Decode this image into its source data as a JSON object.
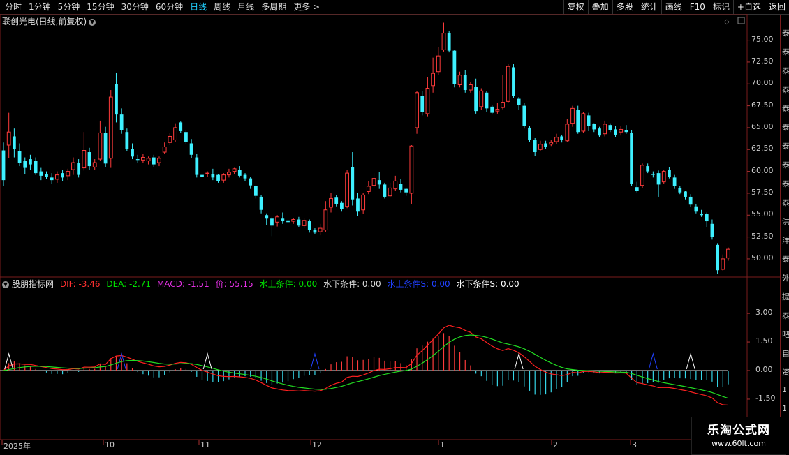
{
  "toolbar": {
    "periods": [
      "分时",
      "1分钟",
      "5分钟",
      "15分钟",
      "30分钟",
      "60分钟",
      "日线",
      "周线",
      "月线",
      "多周期",
      "更多 >"
    ],
    "active_period": "日线",
    "buttons": [
      "复权",
      "叠加",
      "多股",
      "统计",
      "画线",
      "F10",
      "标记",
      "+自选",
      "返回"
    ]
  },
  "main_panel": {
    "title": "联创光电(日线,前复权)",
    "price_ticks": [
      "75.00",
      "72.50",
      "70.00",
      "67.50",
      "65.00",
      "62.50",
      "60.00",
      "57.50",
      "55.00",
      "52.50",
      "50.00"
    ]
  },
  "indicator_panel": {
    "name": "股朋指标网",
    "dif_label": "DIF: -3.46",
    "dea_label": "DEA: -2.71",
    "macd_label": "MACD: -1.51",
    "price_label": "价: 55.15",
    "cond1_label": "水上条件: 0.00",
    "cond2_label": "水下条件: 0.00",
    "cond3_label": "水上条件S: 0.00",
    "cond4_label": "水下条件S: 0.00",
    "value_ticks": [
      "3.00",
      "1.50",
      "0.00",
      "-1.50"
    ],
    "colors": {
      "dif": "#ff3030",
      "dea": "#00e000",
      "macd": "#e030e0",
      "price": "#e030e0",
      "cond1": "#00e000",
      "cond2": "#dddddd",
      "cond3": "#2040ff",
      "cond4": "#ffffff"
    }
  },
  "x_axis": {
    "labels": [
      "2025年",
      "10",
      "11",
      "12",
      "1",
      "2",
      "3"
    ]
  },
  "right_strip": {
    "chars": [
      "泰",
      "泰",
      "泰",
      "泰",
      "泰",
      "泰",
      "泰",
      "泰",
      "泰",
      "泰",
      "洪",
      "洋",
      "泰",
      "外",
      "提",
      "泰",
      "吧",
      "自",
      "资",
      "1",
      "1",
      "1",
      "1"
    ]
  },
  "watermark": {
    "title": "乐淘公式网",
    "url": "www.60lt.com"
  },
  "chart_data": {
    "type": "candlestick",
    "title": "联创光电(日线,前复权)",
    "ylim": [
      48,
      78
    ],
    "candles": [
      [
        60.5,
        62.4,
        59.0,
        58.3,
        63.3
      ],
      [
        62.4,
        63.0,
        64.5,
        61.5,
        66.7
      ],
      [
        64.5,
        64.0,
        62.6,
        61.6,
        64.9
      ],
      [
        62.6,
        62.3,
        61.0,
        60.6,
        63.2
      ],
      [
        61.0,
        61.2,
        60.4,
        59.7,
        61.6
      ],
      [
        60.4,
        61.4,
        60.8,
        60.2,
        61.9
      ],
      [
        60.8,
        61.2,
        59.8,
        59.6,
        61.6
      ],
      [
        59.8,
        60.0,
        59.5,
        59.0,
        60.4
      ],
      [
        59.5,
        59.7,
        59.4,
        59.1,
        60.0
      ],
      [
        59.4,
        59.3,
        59.0,
        58.6,
        59.8
      ],
      [
        59.0,
        59.1,
        59.6,
        58.7,
        60.0
      ],
      [
        59.6,
        59.8,
        59.3,
        58.9,
        60.2
      ],
      [
        59.3,
        59.5,
        60.0,
        59.0,
        60.3
      ],
      [
        60.0,
        60.2,
        61.0,
        59.6,
        61.6
      ],
      [
        61.0,
        61.0,
        59.6,
        59.3,
        61.4
      ],
      [
        59.6,
        60.4,
        62.4,
        60.1,
        64.5
      ],
      [
        62.4,
        62.2,
        60.6,
        60.2,
        62.7
      ],
      [
        60.6,
        60.5,
        61.0,
        60.2,
        61.4
      ],
      [
        61.0,
        61.4,
        64.4,
        61.2,
        65.8
      ],
      [
        64.4,
        64.4,
        60.9,
        60.5,
        65.1
      ],
      [
        60.9,
        61.5,
        68.5,
        60.4,
        69.3
      ],
      [
        68.5,
        70.0,
        66.5,
        65.6,
        71.3
      ],
      [
        66.5,
        66.5,
        64.7,
        64.3,
        67.2
      ],
      [
        64.7,
        64.5,
        62.6,
        62.3,
        64.9
      ],
      [
        62.6,
        62.6,
        61.7,
        61.4,
        63.2
      ],
      [
        61.7,
        61.4,
        61.3,
        61.0,
        61.9
      ],
      [
        61.3,
        61.3,
        61.6,
        61.0,
        62.0
      ],
      [
        61.6,
        61.2,
        61.5,
        60.8,
        61.7
      ],
      [
        61.5,
        61.6,
        60.8,
        60.5,
        61.9
      ],
      [
        60.8,
        61.0,
        61.5,
        60.6,
        61.7
      ],
      [
        61.5,
        62.2,
        62.8,
        62.0,
        63.3
      ],
      [
        62.8,
        63.3,
        64.0,
        63.0,
        64.4
      ],
      [
        64.0,
        63.6,
        65.0,
        63.4,
        65.5
      ],
      [
        65.0,
        65.6,
        64.6,
        64.4,
        65.7
      ],
      [
        64.6,
        64.5,
        63.4,
        63.1,
        64.7
      ],
      [
        63.4,
        63.2,
        61.9,
        61.5,
        63.7
      ],
      [
        61.9,
        61.6,
        59.6,
        59.3,
        62.0
      ],
      [
        59.6,
        59.6,
        59.4,
        59.0,
        59.8
      ],
      [
        59.4,
        59.8,
        59.8,
        59.4,
        60.0
      ],
      [
        59.8,
        59.7,
        59.3,
        59.0,
        60.3
      ],
      [
        59.3,
        59.6,
        58.9,
        58.7,
        59.7
      ],
      [
        58.9,
        59.0,
        59.6,
        58.7,
        59.8
      ],
      [
        59.6,
        59.6,
        59.9,
        59.3,
        60.3
      ],
      [
        59.9,
        60.0,
        60.3,
        59.7,
        60.4
      ],
      [
        60.3,
        60.2,
        59.5,
        59.3,
        60.6
      ],
      [
        59.5,
        59.6,
        59.2,
        58.9,
        59.8
      ],
      [
        59.2,
        59.2,
        58.4,
        58.0,
        59.4
      ],
      [
        58.4,
        58.3,
        57.2,
        56.9,
        58.4
      ],
      [
        57.2,
        57.1,
        55.6,
        55.2,
        57.3
      ],
      [
        55.6,
        55.0,
        54.6,
        53.9,
        55.2
      ],
      [
        54.6,
        54.6,
        53.8,
        52.6,
        54.8
      ],
      [
        53.8,
        54.2,
        54.8,
        53.7,
        55.0
      ],
      [
        54.8,
        54.6,
        54.3,
        54.0,
        55.3
      ],
      [
        54.3,
        54.4,
        54.2,
        53.8,
        54.6
      ],
      [
        54.2,
        54.3,
        54.5,
        54.0,
        54.7
      ],
      [
        54.5,
        54.5,
        53.8,
        53.6,
        54.8
      ],
      [
        53.8,
        53.8,
        54.4,
        53.5,
        54.6
      ],
      [
        54.4,
        54.3,
        53.3,
        53.0,
        54.5
      ],
      [
        53.3,
        53.3,
        53.0,
        52.8,
        53.5
      ],
      [
        53.0,
        53.1,
        53.5,
        52.7,
        54.0
      ],
      [
        53.5,
        53.3,
        55.6,
        53.1,
        56.6
      ],
      [
        55.6,
        55.9,
        56.9,
        55.3,
        57.5
      ],
      [
        56.9,
        57.0,
        56.3,
        56.0,
        57.3
      ],
      [
        56.3,
        56.4,
        55.7,
        55.4,
        56.6
      ],
      [
        55.7,
        56.0,
        59.8,
        55.8,
        60.2
      ],
      [
        59.8,
        60.5,
        56.8,
        56.1,
        62.2
      ],
      [
        56.8,
        56.9,
        55.4,
        54.9,
        57.5
      ],
      [
        55.4,
        55.6,
        57.3,
        55.1,
        57.5
      ],
      [
        57.3,
        57.7,
        58.3,
        57.4,
        58.9
      ],
      [
        58.3,
        58.4,
        59.2,
        58.1,
        59.8
      ],
      [
        59.2,
        59.0,
        58.5,
        58.0,
        59.9
      ],
      [
        58.5,
        58.5,
        57.1,
        56.9,
        58.7
      ],
      [
        57.1,
        57.2,
        58.1,
        57.0,
        58.7
      ],
      [
        58.1,
        58.0,
        58.9,
        57.8,
        59.5
      ],
      [
        58.9,
        58.6,
        57.9,
        57.6,
        59.1
      ],
      [
        57.9,
        58.0,
        57.6,
        57.2,
        58.1
      ],
      [
        57.6,
        57.5,
        62.9,
        56.3,
        63.0
      ],
      [
        62.9,
        65.0,
        69.0,
        64.3,
        69.2
      ],
      [
        69.0,
        68.6,
        66.8,
        66.4,
        69.2
      ],
      [
        66.8,
        66.6,
        69.5,
        66.3,
        70.8
      ],
      [
        69.5,
        69.8,
        71.2,
        69.0,
        73.0
      ],
      [
        71.2,
        71.4,
        73.2,
        71.0,
        74.2
      ],
      [
        73.2,
        73.9,
        75.8,
        73.7,
        77.0
      ],
      [
        75.8,
        75.8,
        73.8,
        73.6,
        76.0
      ],
      [
        73.8,
        73.8,
        70.0,
        69.6,
        73.9
      ],
      [
        70.0,
        69.9,
        71.0,
        69.6,
        71.4
      ],
      [
        71.0,
        71.0,
        69.3,
        69.0,
        71.6
      ],
      [
        69.3,
        69.3,
        69.9,
        69.0,
        70.2
      ],
      [
        69.9,
        69.7,
        66.9,
        66.6,
        70.6
      ],
      [
        66.9,
        67.4,
        69.2,
        67.0,
        69.5
      ],
      [
        69.2,
        69.0,
        67.2,
        66.8,
        69.2
      ],
      [
        67.2,
        67.4,
        66.7,
        66.5,
        67.6
      ],
      [
        66.7,
        66.9,
        67.1,
        66.6,
        67.8
      ],
      [
        67.1,
        67.3,
        67.9,
        67.1,
        71.0
      ],
      [
        67.9,
        68.0,
        72.0,
        67.8,
        72.3
      ],
      [
        72.0,
        71.9,
        68.6,
        68.4,
        72.3
      ],
      [
        68.6,
        68.3,
        67.6,
        67.0,
        68.5
      ],
      [
        67.6,
        67.5,
        65.2,
        64.9,
        67.8
      ],
      [
        65.2,
        65.0,
        63.6,
        63.4,
        65.2
      ],
      [
        63.6,
        63.6,
        62.2,
        61.8,
        63.8
      ],
      [
        62.2,
        62.5,
        63.1,
        62.3,
        63.5
      ],
      [
        63.1,
        63.2,
        62.8,
        62.6,
        63.5
      ],
      [
        62.8,
        63.1,
        63.3,
        62.9,
        63.6
      ],
      [
        63.3,
        63.4,
        63.9,
        63.1,
        64.3
      ],
      [
        63.9,
        64.0,
        63.6,
        63.3,
        64.2
      ],
      [
        63.6,
        63.5,
        65.4,
        63.4,
        66.0
      ],
      [
        65.4,
        65.5,
        67.2,
        65.1,
        67.5
      ],
      [
        67.2,
        67.0,
        64.5,
        64.3,
        67.5
      ],
      [
        64.5,
        64.6,
        66.6,
        64.4,
        66.8
      ],
      [
        66.6,
        66.4,
        65.2,
        64.6,
        66.7
      ],
      [
        65.2,
        65.4,
        64.8,
        64.5,
        65.5
      ],
      [
        64.8,
        64.9,
        64.1,
        63.9,
        65.1
      ],
      [
        64.1,
        64.3,
        65.4,
        64.0,
        65.8
      ],
      [
        65.4,
        65.3,
        64.7,
        64.5,
        65.5
      ],
      [
        64.7,
        64.8,
        64.2,
        63.9,
        65.2
      ],
      [
        64.2,
        64.5,
        64.8,
        64.1,
        65.2
      ],
      [
        64.8,
        64.7,
        64.5,
        64.3,
        65.3
      ],
      [
        64.5,
        64.4,
        58.6,
        58.3,
        64.7
      ],
      [
        58.6,
        58.2,
        57.8,
        57.6,
        58.8
      ],
      [
        57.8,
        58.4,
        60.7,
        58.1,
        60.9
      ],
      [
        60.7,
        60.6,
        60.0,
        59.8,
        60.9
      ],
      [
        60.0,
        59.7,
        59.6,
        59.3,
        60.0
      ],
      [
        59.6,
        59.8,
        58.5,
        57.1,
        60.1
      ],
      [
        58.5,
        58.8,
        60.0,
        58.6,
        60.2
      ],
      [
        60.0,
        60.2,
        59.4,
        59.2,
        60.5
      ],
      [
        59.4,
        59.3,
        58.3,
        58.0,
        59.6
      ],
      [
        58.3,
        58.1,
        57.6,
        57.4,
        58.3
      ],
      [
        57.6,
        57.7,
        57.1,
        56.8,
        57.8
      ],
      [
        57.1,
        57.1,
        56.2,
        55.9,
        57.4
      ],
      [
        56.2,
        56.0,
        55.4,
        55.2,
        56.3
      ],
      [
        55.4,
        55.1,
        55.0,
        54.8,
        55.6
      ],
      [
        55.0,
        55.1,
        54.3,
        53.6,
        55.3
      ],
      [
        54.3,
        54.0,
        52.5,
        52.2,
        54.5
      ],
      [
        52.5,
        51.6,
        48.7,
        48.3,
        51.8
      ],
      [
        48.7,
        48.8,
        50.0,
        48.6,
        50.5
      ],
      [
        50.0,
        50.1,
        51.1,
        49.8,
        51.3
      ]
    ],
    "macd_axis_range": [
      -2.6,
      4.3
    ],
    "dif": [
      -0.9,
      -1.3,
      -1.8,
      -2.1,
      -2.2
    ],
    "dea": [
      -0.5,
      -1.2,
      -1.9,
      -2.4,
      -2.6
    ]
  }
}
